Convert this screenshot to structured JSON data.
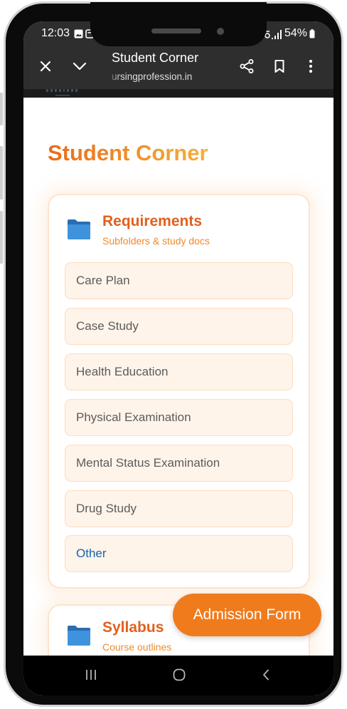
{
  "status_bar": {
    "time": "12:03",
    "battery": "54%",
    "icons": [
      "gallery-notification-icon",
      "notification-icon",
      "signal-icon",
      "battery-icon"
    ]
  },
  "toolbar": {
    "title": "Student Corner",
    "url": "ursingprofession.in",
    "icons": {
      "close": "close-icon",
      "minimize": "chevron-down-icon",
      "share": "share-icon",
      "bookmark": "bookmark-icon",
      "more": "more-vert-icon"
    }
  },
  "page": {
    "title": "Student Corner"
  },
  "sections": [
    {
      "title": "Requirements",
      "subtitle": "Subfolders & study docs",
      "icon": "folder-icon",
      "items": [
        {
          "label": "Care Plan"
        },
        {
          "label": "Case Study"
        },
        {
          "label": "Health Education"
        },
        {
          "label": "Physical Examination"
        },
        {
          "label": "Mental Status Examination"
        },
        {
          "label": "Drug Study"
        },
        {
          "label": "Other",
          "is_link": true
        }
      ]
    },
    {
      "title": "Syllabus",
      "subtitle": "Course outlines",
      "icon": "folder-icon"
    }
  ],
  "floating_button": {
    "label": "Admission Form"
  },
  "nav_bar": {
    "icons": [
      "recent-apps-icon",
      "home-icon",
      "back-icon"
    ]
  },
  "colors": {
    "accent": "#f07b1d",
    "heading_start": "#e86c1c",
    "heading_end": "#f4b03a",
    "section_title": "#e1601d",
    "subtitle": "#ef8b2a",
    "link": "#1862b0",
    "folder": "#3f93dc",
    "folder_back": "#2a6db3",
    "toolbar_bg": "#2e2e2e",
    "item_bg": "#fff4ea",
    "item_border": "#fcdcbf",
    "item_text": "#5b5b5b"
  }
}
